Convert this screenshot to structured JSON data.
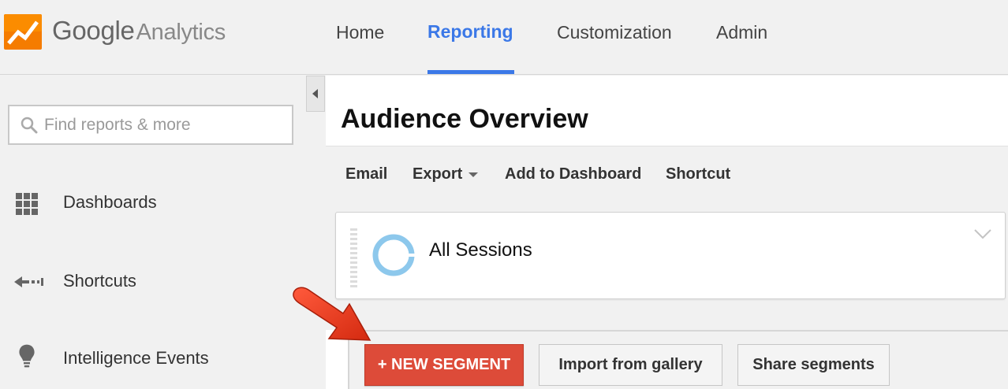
{
  "app": {
    "logo_google": "Google",
    "logo_product": "Analytics"
  },
  "nav": {
    "items": [
      {
        "label": "Home",
        "active": false
      },
      {
        "label": "Reporting",
        "active": true
      },
      {
        "label": "Customization",
        "active": false
      },
      {
        "label": "Admin",
        "active": false
      }
    ]
  },
  "sidebar": {
    "search": {
      "placeholder": "Find reports & more",
      "icon": "search-icon"
    },
    "items": [
      {
        "label": "Dashboards",
        "icon": "grid-icon"
      },
      {
        "label": "Shortcuts",
        "icon": "shortcut-arrow-icon"
      },
      {
        "label": "Intelligence Events",
        "icon": "lightbulb-icon"
      }
    ]
  },
  "main": {
    "title": "Audience Overview",
    "toolbar": {
      "email": "Email",
      "export": "Export",
      "add_dashboard": "Add to Dashboard",
      "shortcut": "Shortcut"
    },
    "segment": {
      "label": "All Sessions"
    },
    "segment_builder": {
      "new_segment": "+ NEW SEGMENT",
      "import": "Import from gallery",
      "share": "Share segments"
    }
  },
  "colors": {
    "accent": "#3b78e7",
    "primary_button": "#dd4b39",
    "segment_ring": "#8dc8ec",
    "logo_orange": "#f57c00",
    "annotation_arrow": "#e8391f"
  }
}
